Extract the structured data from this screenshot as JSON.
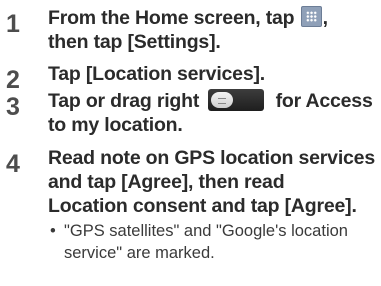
{
  "steps": [
    {
      "number": "1",
      "text_a": "From the Home screen, tap ",
      "icon_a": "apps-grid-icon",
      "text_b": ",",
      "line2": "then tap [Settings]."
    },
    {
      "number": "2",
      "text_a": "Tap [Location services]."
    },
    {
      "number": "3",
      "text_a": "Tap or drag right ",
      "icon_a": "toggle-switch-icon",
      "text_b": " for Access",
      "line2": "to my location."
    },
    {
      "number": "4",
      "line1": "Read note on GPS location services",
      "line2": "and tap [Agree], then read",
      "line3": "Location consent and tap [Agree].",
      "bullet_marker": "•",
      "bullet_line1": "\"GPS satellites\" and \"Google's location",
      "bullet_line2": "service\" are marked."
    }
  ]
}
